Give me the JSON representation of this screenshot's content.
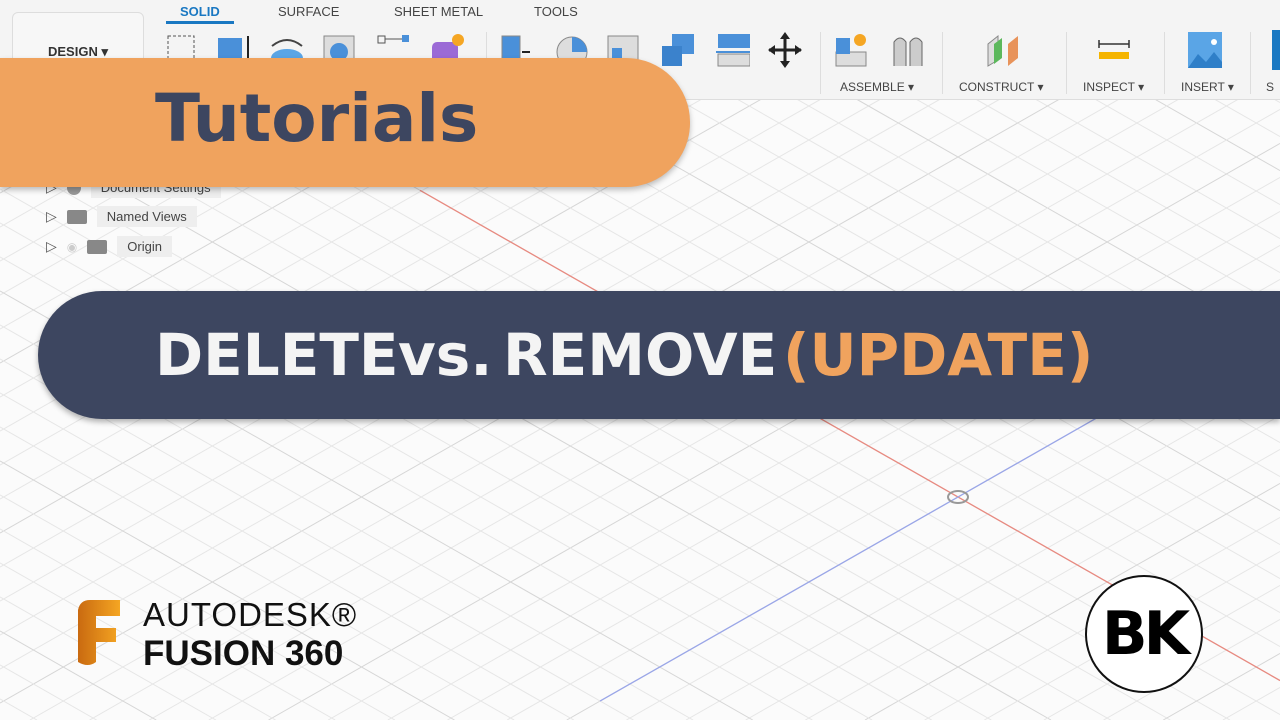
{
  "toolbar": {
    "workspace": "DESIGN ▾",
    "tabs": [
      "SOLID",
      "SURFACE",
      "SHEET METAL",
      "TOOLS"
    ],
    "active_tab": "SOLID",
    "groups": [
      "ASSEMBLE ▾",
      "CONSTRUCT ▾",
      "INSPECT ▾",
      "INSERT ▾",
      "S"
    ]
  },
  "browser": {
    "items": [
      "Document Settings",
      "Named Views",
      "Origin"
    ]
  },
  "banner": {
    "category": "Tutorials",
    "title_part1": "DELETE",
    "title_vs": "vs.",
    "title_part2": "REMOVE",
    "title_update": "(UPDATE)"
  },
  "branding": {
    "autodesk": "AUTODESK®",
    "product": "FUSION 360",
    "channel_logo": "BK"
  },
  "colors": {
    "orange": "#F0A35E",
    "navy": "#3D4660",
    "x_axis": "#e88a80",
    "y_axis": "#9aa6e8",
    "accent": "#1a78c2"
  }
}
